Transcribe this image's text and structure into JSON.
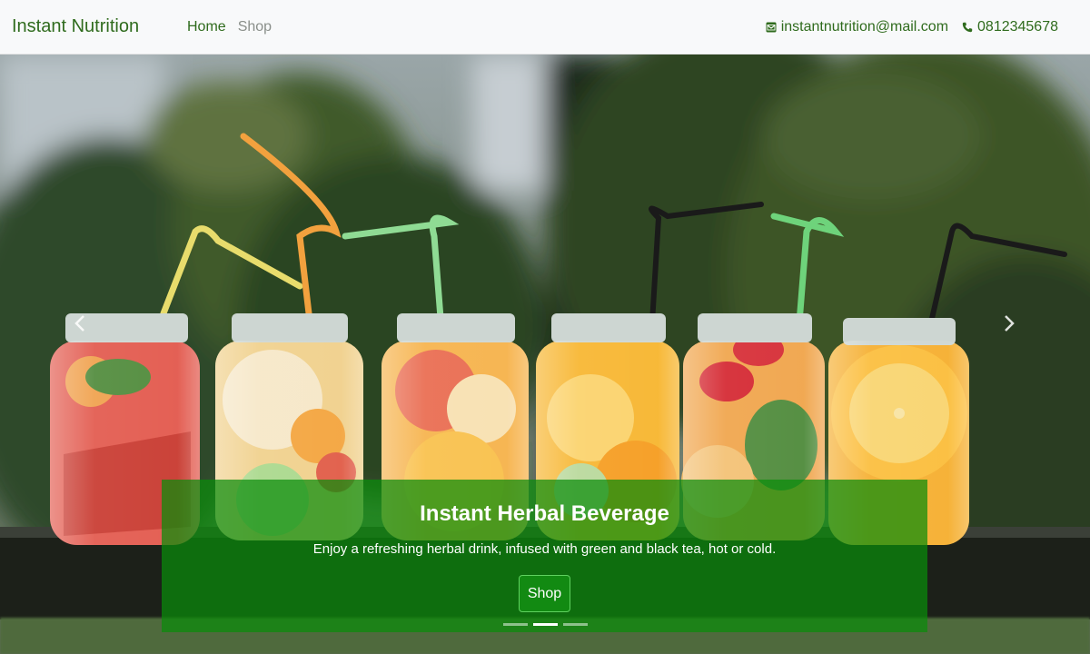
{
  "navbar": {
    "brand": "Instant Nutrition",
    "links": [
      {
        "label": "Home"
      },
      {
        "label": "Shop"
      }
    ],
    "contact": {
      "email": "instantnutrition@mail.com",
      "phone": "0812345678"
    }
  },
  "hero": {
    "title": "Instant Herbal Beverage",
    "description": "Enjoy a refreshing herbal drink, infused with green and black tea, hot or cold.",
    "button_label": "Shop",
    "slides": 3,
    "active_slide": 2
  },
  "colors": {
    "brand": "#2f6b1d",
    "caption_bg": "rgba(10,140,10,0.72)",
    "navbar_bg": "#f8f9fa"
  },
  "icons": {
    "email": "envelope-icon",
    "phone": "phone-icon",
    "prev": "chevron-left-icon",
    "next": "chevron-right-icon"
  }
}
